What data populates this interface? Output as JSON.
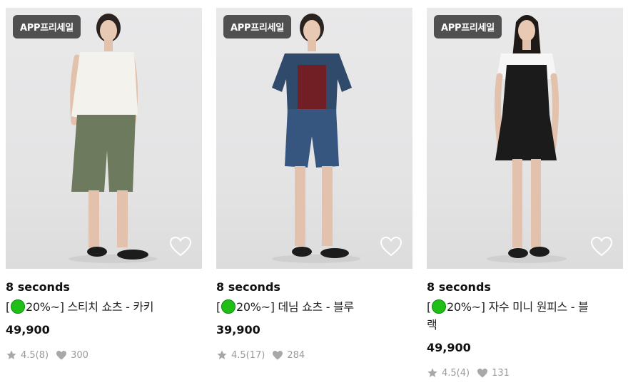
{
  "products": [
    {
      "badge": "APP프리세일",
      "brand": "8 seconds",
      "name_prefix": "[",
      "name_discount": "20%~]",
      "name_rest": " 스티치 쇼츠 - 카키",
      "price": "49,900",
      "rating": "4.5(8)",
      "likes": "300",
      "outfit": {
        "top": "#f4f2ec",
        "bottom": "#6d7a5e"
      }
    },
    {
      "badge": "APP프리세일",
      "brand": "8 seconds",
      "name_prefix": "[",
      "name_discount": "20%~]",
      "name_rest": " 데님 쇼츠 - 블루",
      "price": "39,900",
      "rating": "4.5(17)",
      "likes": "284",
      "outfit": {
        "top": "#2f4a6b",
        "bottom": "#36557f"
      }
    },
    {
      "badge": "APP프리세일",
      "brand": "8 seconds",
      "name_prefix": "[",
      "name_discount": "20%~]",
      "name_rest": " 자수 미니 원피스 - 블랙",
      "price": "49,900",
      "rating": "4.5(4)",
      "likes": "131",
      "outfit": {
        "top": "#1b1b1b",
        "bottom": "#1b1b1b"
      }
    }
  ],
  "icons": {
    "wishlist": "heart-outline-icon",
    "rating": "star-icon",
    "likes": "heart-filled-icon",
    "discount_dot": "green-circle-icon"
  },
  "colors": {
    "badge_bg": "#505050",
    "discount_dot": "#1fbf17",
    "meta_text": "#9a9a9a"
  }
}
